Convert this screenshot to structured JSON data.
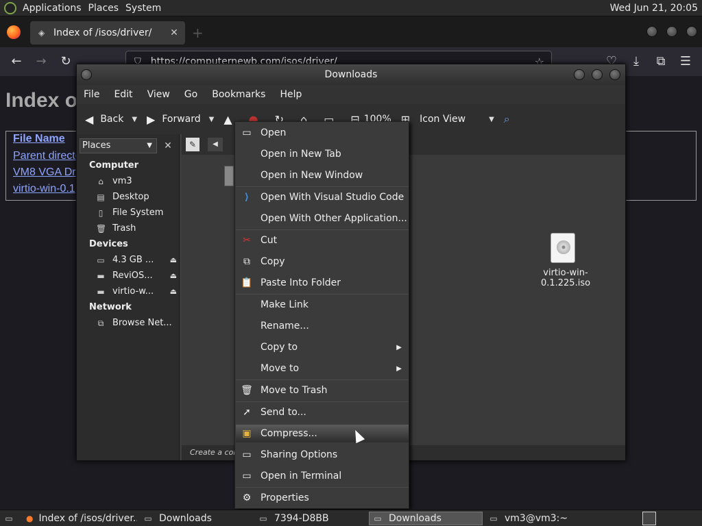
{
  "top_panel": {
    "menus": [
      "Applications",
      "Places",
      "System"
    ],
    "clock": "Wed Jun 21, 20:05"
  },
  "firefox": {
    "tab_title": "Index of /isos/driver/",
    "tab_close": "✕",
    "new_tab": "+",
    "url": "https://computernewb.com/isos/driver/",
    "icons": {
      "back": "←",
      "forward": "→",
      "reload": "↻",
      "pocket": "♡",
      "downloads": "⤓",
      "extensions": "⧉",
      "menu": "☰",
      "star": "☆",
      "shield": "⛉",
      "lock": "🔒"
    }
  },
  "web": {
    "title": "Index o",
    "header_link": "File Name",
    "links": [
      "Parent directory/",
      "VM8 VGA Dr",
      "virtio-win-0.1"
    ]
  },
  "nautilus": {
    "title": "Downloads",
    "menubar": [
      "File",
      "Edit",
      "View",
      "Go",
      "Bookmarks",
      "Help"
    ],
    "toolbar": {
      "back": "Back",
      "forward": "Forward",
      "zoom": "100%",
      "view_mode": "Icon View"
    },
    "sidebar": {
      "combo": "Places",
      "close": "✕",
      "sections": [
        {
          "heading": "Computer",
          "items": [
            {
              "label": "vm3",
              "icon": "home-icon"
            },
            {
              "label": "Desktop",
              "icon": "desktop-icon"
            },
            {
              "label": "File System",
              "icon": "drive-icon"
            },
            {
              "label": "Trash",
              "icon": "trash-icon"
            }
          ]
        },
        {
          "heading": "Devices",
          "items": [
            {
              "label": "4.3 GB ...",
              "icon": "drive-icon",
              "eject": "⏏"
            },
            {
              "label": "ReviOS...",
              "icon": "disc-icon",
              "eject": "⏏"
            },
            {
              "label": "virtio-w...",
              "icon": "disc-icon",
              "eject": "⏏"
            }
          ]
        },
        {
          "heading": "Network",
          "items": [
            {
              "label": "Browse Net...",
              "icon": "network-icon"
            }
          ]
        }
      ]
    },
    "file": {
      "name": "virtio-win-0.1.225.iso"
    },
    "status": "Create a com"
  },
  "context_menu": {
    "items": [
      {
        "label": "Open",
        "icon": "folder-icon",
        "glyph": "▭"
      },
      {
        "label": "Open in New Tab",
        "icon": "",
        "glyph": ""
      },
      {
        "label": "Open in New Window",
        "icon": "",
        "glyph": ""
      },
      {
        "label": "Open With Visual Studio Code",
        "icon": "vscode-icon",
        "glyph": "⟩"
      },
      {
        "label": "Open With Other Application...",
        "icon": "",
        "glyph": ""
      },
      {
        "label": "Cut",
        "icon": "scissors-icon",
        "glyph": "✂"
      },
      {
        "label": "Copy",
        "icon": "copy-icon",
        "glyph": "⧉"
      },
      {
        "label": "Paste Into Folder",
        "icon": "clipboard-icon",
        "glyph": "📋"
      },
      {
        "label": "Make Link",
        "icon": "",
        "glyph": ""
      },
      {
        "label": "Rename...",
        "icon": "",
        "glyph": ""
      },
      {
        "label": "Copy to",
        "icon": "",
        "glyph": "",
        "submenu": "▶"
      },
      {
        "label": "Move to",
        "icon": "",
        "glyph": "",
        "submenu": "▶"
      },
      {
        "label": "Move to Trash",
        "icon": "trash-icon",
        "glyph": "🗑"
      },
      {
        "label": "Send to...",
        "icon": "send-icon",
        "glyph": "➚"
      },
      {
        "label": "Compress...",
        "icon": "archive-icon",
        "glyph": "▣"
      },
      {
        "label": "Sharing Options",
        "icon": "share-icon",
        "glyph": "▭"
      },
      {
        "label": "Open in Terminal",
        "icon": "terminal-icon",
        "glyph": "▭"
      },
      {
        "label": "Properties",
        "icon": "properties-icon",
        "glyph": "⚙"
      }
    ]
  },
  "taskbar": {
    "tasks": [
      {
        "label": "Index of /isos/driver...",
        "icon": "firefox-icon"
      },
      {
        "label": "Downloads",
        "icon": "folder-icon"
      },
      {
        "label": "7394-D8BB",
        "icon": "drive-icon"
      },
      {
        "label": "Downloads",
        "icon": "folder-icon"
      },
      {
        "label": "vm3@vm3:~",
        "icon": "terminal-icon"
      }
    ]
  }
}
